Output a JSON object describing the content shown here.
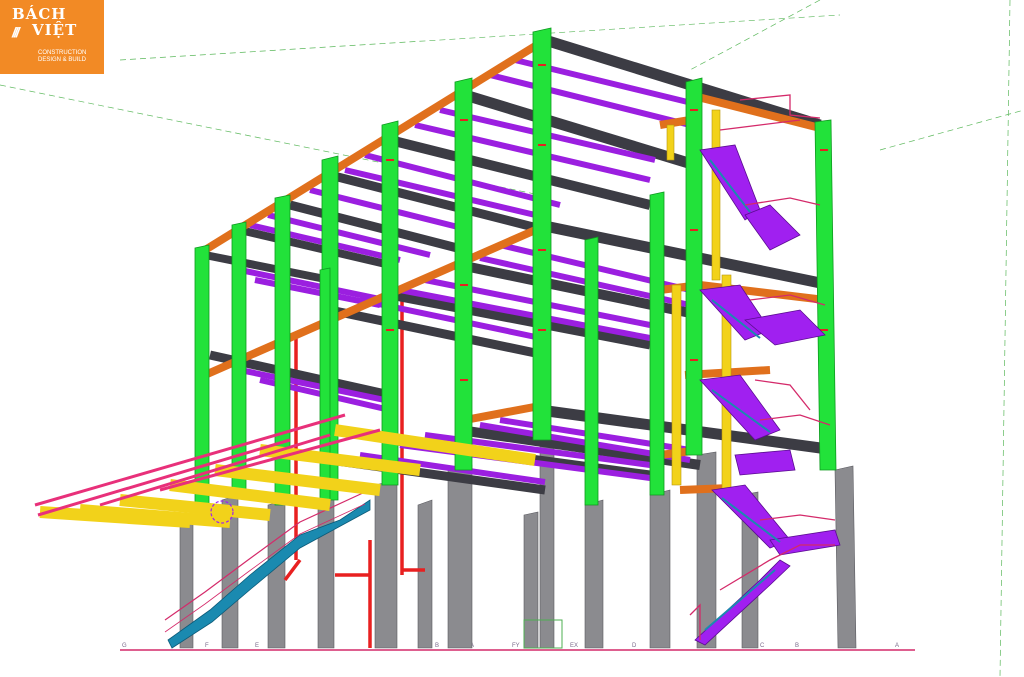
{
  "logo": {
    "line1": "BÁCH",
    "line2": "VIỆT",
    "slashes": "///",
    "tagline1": "CONSTRUCTION",
    "tagline2": "DESIGN & BUILD",
    "background": "#f28a25"
  },
  "grid_labels": [
    "G",
    "F",
    "E",
    "D",
    "C",
    "B",
    "A",
    "FY",
    "EX",
    "D",
    "C",
    "B",
    "A"
  ],
  "colors": {
    "columns_steel": "#22e23a",
    "columns_concrete": "#8b8b8f",
    "girders": "#4a4a52",
    "edge_beams": "#e0701c",
    "joists": "#9b1fe0",
    "canopy_beams": "#f2d21a",
    "canopy_rafters": "#e8307a",
    "braces": "#e82020",
    "stairs": "#a020f0",
    "stair_treads": "#1a8ab0",
    "railings": "#d42a6a",
    "grid_lines": "#4caf50"
  }
}
